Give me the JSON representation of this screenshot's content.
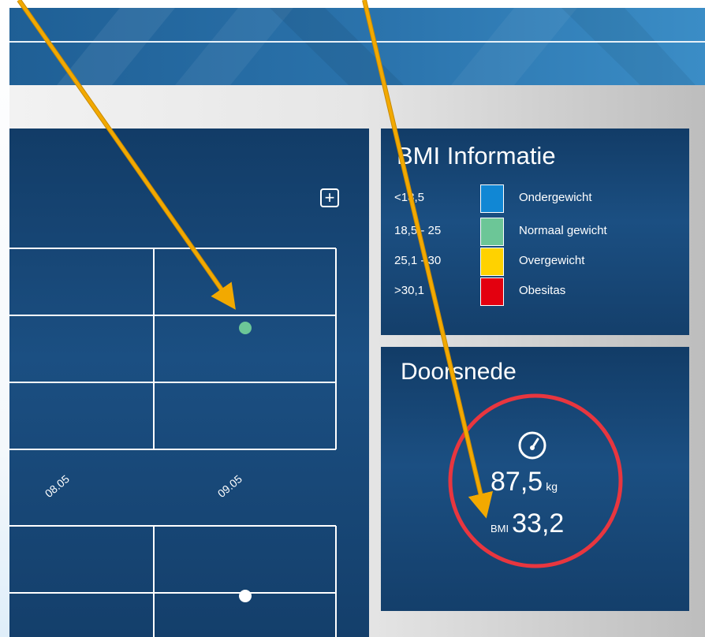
{
  "chart": {
    "x_ticks": [
      "08.05",
      "09.05"
    ],
    "add_label": "+"
  },
  "bmi_info": {
    "title": "BMI Informatie",
    "rows": [
      {
        "range": "<18,5",
        "label": "Ondergewicht",
        "color": "#1187d4"
      },
      {
        "range": "18,5 - 25",
        "label": "Normaal gewicht",
        "color": "#6cc697"
      },
      {
        "range": "25,1 - 30",
        "label": "Overgewicht",
        "color": "#ffd200"
      },
      {
        "range": ">30,1",
        "label": "Obesitas",
        "color": "#e3000f"
      }
    ]
  },
  "average": {
    "title": "Doorsnede",
    "weight_value": "87,5",
    "weight_unit": "kg",
    "bmi_label": "BMI",
    "bmi_value": "33,2",
    "ring_color": "#e8363f"
  },
  "colors": {
    "arrow": "#f2a900",
    "point_normal": "#6cc697",
    "point_white": "#ffffff"
  }
}
